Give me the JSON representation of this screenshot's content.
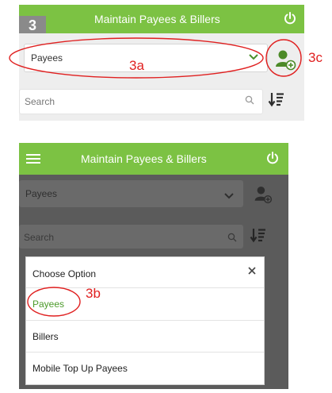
{
  "step_labels": {
    "badge": "3",
    "a": "3a",
    "b": "3b",
    "c": "3c"
  },
  "top_screen": {
    "header_title": "Maintain Payees & Billers",
    "dropdown_value": "Payees",
    "search_placeholder": "Search"
  },
  "bottom_screen": {
    "header_title": "Maintain Payees & Billers",
    "dropdown_value": "Payees",
    "search_placeholder": "Search",
    "modal": {
      "title": "Choose Option",
      "options": [
        "Payees",
        "Billers",
        "Mobile Top Up Payees"
      ],
      "selected_option": "Payees"
    }
  },
  "colors": {
    "header_green": "#7cc243",
    "annotation_red": "#e02020",
    "selected_option_green": "#4c9a2a"
  }
}
